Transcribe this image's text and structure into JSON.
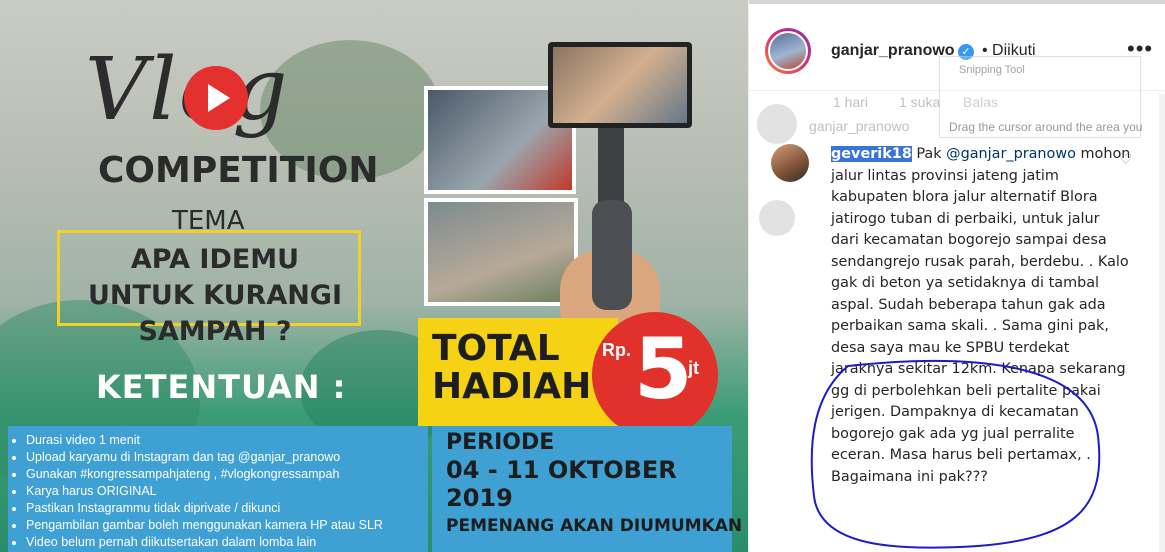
{
  "poster": {
    "vlog_title": "Vlog",
    "competition": "COMPETITION",
    "tema_label": "TEMA",
    "tema_text": "APA IDEMU UNTUK KURANGI SAMPAH ?",
    "total_hadiah": "TOTAL HADIAH",
    "prize_currency": "Rp.",
    "prize_amount": "5",
    "prize_unit": "jt",
    "ketentuan": "KETENTUAN :",
    "rules": [
      "Durasi video 1 menit",
      "Upload karyamu di Instagram dan tag @ganjar_pranowo",
      "Gunakan #kongressampahjateng , #vlogkongressampah",
      "Karya harus ORIGINAL",
      "Pastikan Instagrammu tidak diprivate / dikunci",
      "Pengambilan gambar boleh menggunakan kamera HP atau SLR",
      "Video belum pernah diikutsertakan dalam lomba lain"
    ],
    "periode_label": "PERIODE",
    "periode_dates": "04 - 11 OKTOBER 2019",
    "pemenang": "PEMENANG AKAN DIUMUMKAN"
  },
  "header": {
    "username": "ganjar_pranowo",
    "follow_status": "• Diikuti",
    "more": "•••"
  },
  "faded_row": {
    "time": "1 hari",
    "likes": "1 suka",
    "reply": "Balas",
    "ghost_user": "ganjar_pranowo",
    "snip_title": "Snipping Tool",
    "snip_hint": "Drag the cursor around the area you"
  },
  "comment": {
    "user": "geverik18",
    "mention": "@ganjar_pranowo",
    "prefix": "Pak",
    "text": "mohon jalur lintas provinsi jateng jatim kabupaten blora jalur alternatif Blora jatirogo tuban di perbaiki, untuk jalur dari kecamatan bogorejo sampai desa sendangrejo rusak parah, berdebu. . Kalo gak di beton ya setidaknya di tambal aspal. Sudah beberapa tahun gak ada perbaikan sama skali. . Sama gini pak, desa saya mau ke SPBU terdekat jaraknya sekitar 12km. Kenapa sekarang gg di perbolehkan beli pertalite pakai jerigen. Dampaknya di kecamatan bogorejo gak ada yg jual perralite eceran. Masa harus beli pertamax, . Bagaimana ini pak???"
  },
  "colors": {
    "verified": "#3897f0",
    "annotation_circle": "#1c1cc9",
    "highlight": "#3a73d9"
  }
}
